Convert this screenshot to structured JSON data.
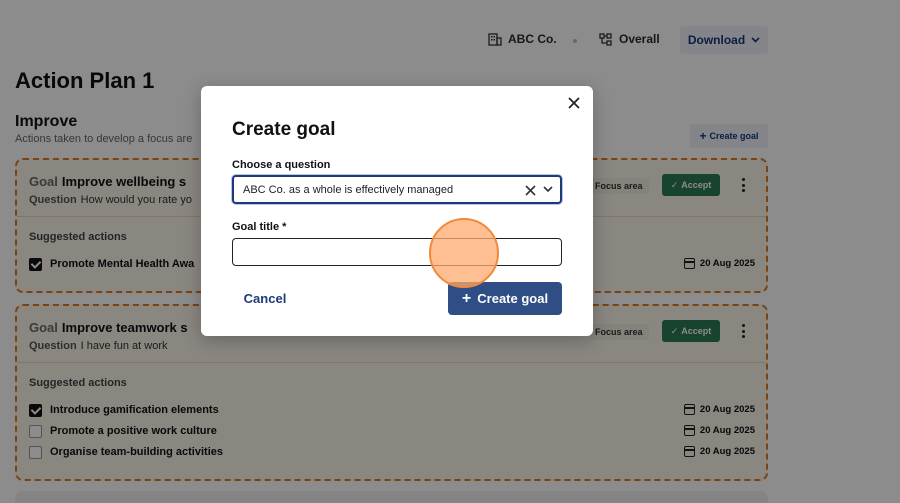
{
  "header": {
    "org_name": "ABC Co.",
    "org_icon": "building-icon",
    "scope_label": "Overall",
    "scope_icon": "hierarchy-icon",
    "download_label": "Download"
  },
  "plan": {
    "title": "Action Plan 1",
    "section_title": "Improve",
    "section_subtitle": "Actions taken to develop a focus are",
    "create_goal_label": "Create goal"
  },
  "cards": [
    {
      "goal_keyword": "Goal",
      "goal_title": "Improve wellbeing s",
      "question_keyword": "Question",
      "question_text": "How would you rate yo",
      "focus_badge": "Focus area",
      "accept_label": "Accept",
      "suggested_title": "Suggested actions",
      "actions": [
        {
          "label": "Promote Mental Health Awa",
          "checked": true,
          "date": "20 Aug 2025"
        }
      ]
    },
    {
      "goal_keyword": "Goal",
      "goal_title": "Improve teamwork s",
      "question_keyword": "Question",
      "question_text": "I have fun at work",
      "focus_badge": "Focus area",
      "accept_label": "Accept",
      "suggested_title": "Suggested actions",
      "actions": [
        {
          "label": "Introduce gamification elements",
          "checked": true,
          "date": "20 Aug 2025"
        },
        {
          "label": "Promote a positive work culture",
          "checked": false,
          "date": "20 Aug 2025"
        },
        {
          "label": "Organise team-building activities",
          "checked": false,
          "date": "20 Aug 2025"
        }
      ]
    }
  ],
  "modal": {
    "title": "Create goal",
    "question_label": "Choose a question",
    "question_value": "ABC Co. as a whole is effectively managed",
    "goal_title_label": "Goal title *",
    "goal_title_value": "",
    "cancel_label": "Cancel",
    "submit_label": "Create goal"
  },
  "colors": {
    "primary": "#2f4e86",
    "accept_green": "#2a7a56",
    "focus_border": "#e07a1f",
    "click_indicator": "#f08a3a"
  }
}
